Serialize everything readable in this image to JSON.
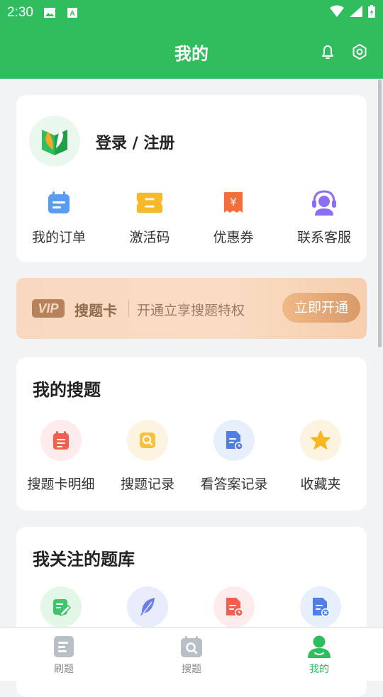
{
  "status": {
    "time": "2:30"
  },
  "header": {
    "title": "我的"
  },
  "profile": {
    "login_label": "登录 / 注册"
  },
  "quick_actions": [
    {
      "label": "我的订单",
      "icon": "calendar-icon"
    },
    {
      "label": "激活码",
      "icon": "ticket-icon"
    },
    {
      "label": "优惠券",
      "icon": "coupon-icon"
    },
    {
      "label": "联系客服",
      "icon": "headset-icon"
    }
  ],
  "vip": {
    "badge": "VIP",
    "name": "搜题卡",
    "desc": "开通立享搜题特权",
    "button": "立即开通"
  },
  "my_search": {
    "title": "我的搜题",
    "items": [
      {
        "label": "搜题卡明细",
        "icon": "card-detail-icon"
      },
      {
        "label": "搜题记录",
        "icon": "search-record-icon"
      },
      {
        "label": "看答案记录",
        "icon": "answer-record-icon"
      },
      {
        "label": "收藏夹",
        "icon": "star-icon"
      }
    ]
  },
  "followed": {
    "title": "我关注的题库",
    "items": [
      {
        "icon": "edit-doc-icon"
      },
      {
        "icon": "feather-icon"
      },
      {
        "icon": "clock-doc-icon"
      },
      {
        "icon": "remove-doc-icon"
      }
    ]
  },
  "tabs": [
    {
      "label": "刷题",
      "icon": "practice-icon"
    },
    {
      "label": "搜题",
      "icon": "search-tab-icon"
    },
    {
      "label": "我的",
      "icon": "profile-icon"
    }
  ],
  "colors": {
    "brand": "#2fbd5d",
    "vip_gold": "#b5825c"
  }
}
